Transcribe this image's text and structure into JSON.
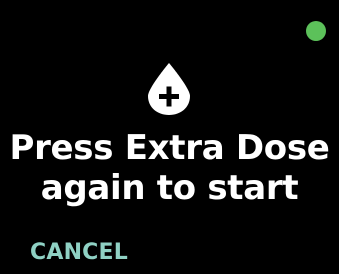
{
  "screen": {
    "message_line1": "Press Extra Dose",
    "message_line2": "again to start",
    "cancel_label": "CANCEL",
    "icon": "drop-plus-icon",
    "status_indicator": "green-dot"
  },
  "colors": {
    "background": "#000000",
    "text": "#ffffff",
    "accent": "#8fd1c4",
    "status_dot": "#5cc15a"
  }
}
